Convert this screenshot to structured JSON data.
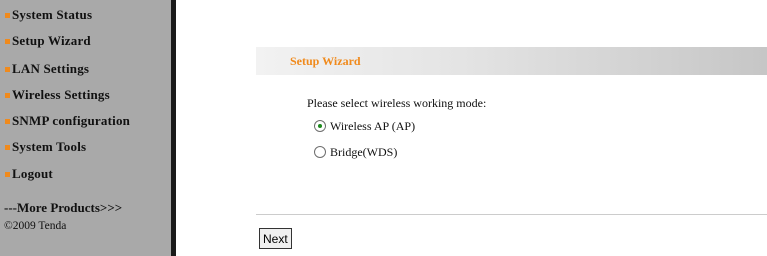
{
  "sidebar": {
    "items": [
      {
        "label": "System Status"
      },
      {
        "label": "Setup Wizard"
      },
      {
        "label": "LAN Settings"
      },
      {
        "label": "Wireless Settings"
      },
      {
        "label": "SNMP configuration"
      },
      {
        "label": "System Tools"
      },
      {
        "label": "Logout"
      }
    ],
    "more_products": "---More Products>>>",
    "copyright": "©2009 Tenda"
  },
  "wizard": {
    "title": "Setup Wizard",
    "prompt": "Please select wireless working mode:",
    "options": [
      {
        "label": "Wireless AP (AP)",
        "selected": true
      },
      {
        "label": "Bridge(WDS)",
        "selected": false
      }
    ],
    "next_label": "Next"
  },
  "colors": {
    "sidebar_bg": "#a9a9a9",
    "accent": "#f08a1c",
    "header_gradient_end": "#c6c6c6"
  }
}
